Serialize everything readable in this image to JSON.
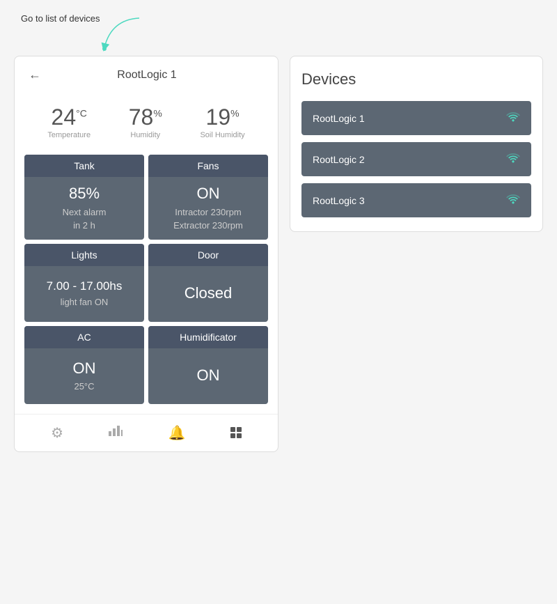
{
  "annotation": {
    "text": "Go to list of devices"
  },
  "device_panel": {
    "title": "RootLogic 1",
    "back_label": "←",
    "stats": [
      {
        "value": "24",
        "unit": "°C",
        "label": "Temperature"
      },
      {
        "value": "78",
        "unit": "%",
        "label": "Humidity"
      },
      {
        "value": "19",
        "unit": "%",
        "label": "Soil Humidity"
      }
    ],
    "widgets": [
      {
        "id": "tank",
        "header": "Tank",
        "value": "85%",
        "sub": "Next alarm\nin 2 h"
      },
      {
        "id": "fans",
        "header": "Fans",
        "value": "ON",
        "sub": "Intractor 230rpm\nExtractor 230rpm"
      },
      {
        "id": "lights",
        "header": "Lights",
        "value": "7.00 - 17.00hs",
        "sub": "light fan ON"
      },
      {
        "id": "door",
        "header": "Door",
        "value": "Closed",
        "sub": ""
      },
      {
        "id": "ac",
        "header": "AC",
        "value": "ON",
        "sub": "25°C"
      },
      {
        "id": "humidificator",
        "header": "Humidificator",
        "value": "ON",
        "sub": ""
      }
    ],
    "nav_icons": [
      "settings",
      "chart",
      "bell",
      "grid"
    ]
  },
  "devices_panel": {
    "title": "Devices",
    "devices": [
      {
        "name": "RootLogic 1",
        "connected": true
      },
      {
        "name": "RootLogic 2",
        "connected": true
      },
      {
        "name": "RootLogic 3",
        "connected": true
      }
    ]
  }
}
